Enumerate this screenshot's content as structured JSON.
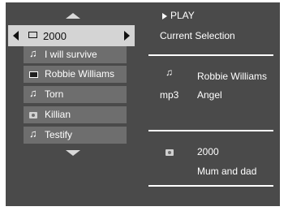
{
  "player": {
    "play_label": "PLAY",
    "current_selection_label": "Current Selection"
  },
  "browser": {
    "selected": {
      "label": "2000",
      "icon": "folder-icon"
    },
    "items": [
      {
        "label": "I will survive",
        "icon": "music-note-icon"
      },
      {
        "label": "Robbie Williams",
        "icon": "folder-icon"
      },
      {
        "label": "Torn",
        "icon": "music-note-icon"
      },
      {
        "label": "Killian",
        "icon": "camera-icon"
      },
      {
        "label": "Testify",
        "icon": "music-note-icon"
      }
    ]
  },
  "details": {
    "track": {
      "icon": "music-note-icon",
      "artist": "Robbie Williams",
      "format": "mp3",
      "title": "Angel"
    },
    "photo": {
      "icon": "camera-icon",
      "year": "2000",
      "album": "Mum and dad"
    }
  }
}
